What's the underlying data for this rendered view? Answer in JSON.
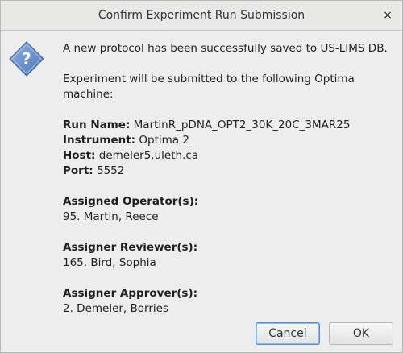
{
  "window": {
    "title": "Confirm Experiment Run Submission",
    "close_glyph": "×"
  },
  "icon": {
    "name": "question-icon",
    "glyph": "?",
    "color": "#6a8fc9"
  },
  "message": {
    "intro": "A new protocol has been successfully saved to US-LIMS DB.",
    "submit_text": "Experiment will be submitted to the following Optima machine:",
    "run_name_label": "Run Name:",
    "run_name_value": "MartinR_pDNA_OPT2_30K_20C_3MAR25",
    "instrument_label": "Instrument:",
    "instrument_value": "Optima 2",
    "host_label": "Host:",
    "host_value": "demeler5.uleth.ca",
    "port_label": "Port:",
    "port_value": "5552",
    "operator_label": "Assigned Operator(s):",
    "operator_value": "95. Martin, Reece",
    "reviewer_label": "Assigner Reviewer(s):",
    "reviewer_value": "165. Bird, Sophia",
    "approver_label": "Assigner Approver(s):",
    "approver_value": "2. Demeler, Borries"
  },
  "buttons": {
    "cancel_label": "Cancel",
    "ok_label": "OK"
  }
}
